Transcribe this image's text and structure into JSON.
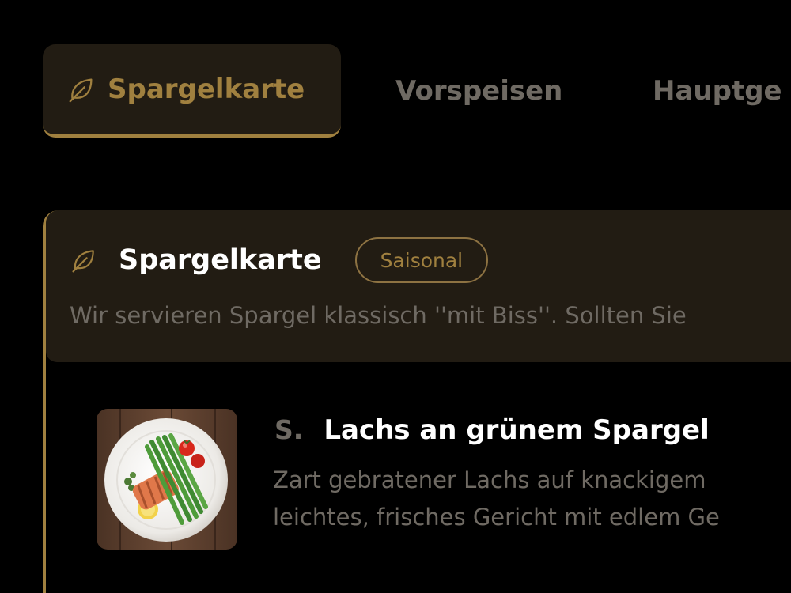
{
  "colors": {
    "accent": "#a0803f",
    "panel": "#221c13",
    "muted_text": "#6f6a63",
    "title_text": "#ffffff",
    "background": "#000000"
  },
  "tabs": [
    {
      "label": "Spargelkarte",
      "icon": "leaf-icon",
      "active": true
    },
    {
      "label": "Vorspeisen",
      "active": false
    },
    {
      "label": "Hauptge",
      "active": false
    }
  ],
  "section": {
    "icon": "leaf-icon",
    "title": "Spargelkarte",
    "badge": "Saisonal",
    "description": "Wir servieren Spargel klassisch ''mit Biss''. Sollten Sie"
  },
  "dish": {
    "code": "S.",
    "name": "Lachs an grünem Spargel",
    "description_line1": "Zart gebratener Lachs auf knackigem",
    "description_line2": "leichtes, frisches Gericht mit edlem Ge",
    "image": "salmon-asparagus-plate-photo"
  }
}
